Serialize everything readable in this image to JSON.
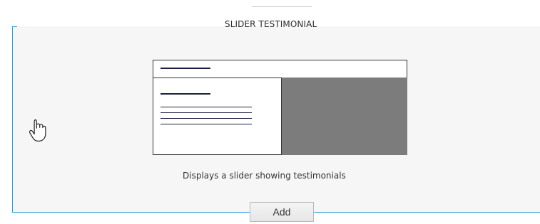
{
  "widget": {
    "title": "SLIDER TESTIMONIAL",
    "description": "Displays a slider showing testimonials",
    "add_label": "Add"
  },
  "colors": {
    "accent_line": "#2aa0d8",
    "preview_block": "#7c7c7c",
    "card_background": "#f6f6f6"
  },
  "icons": {
    "cursor": "hand-pointer-icon"
  }
}
